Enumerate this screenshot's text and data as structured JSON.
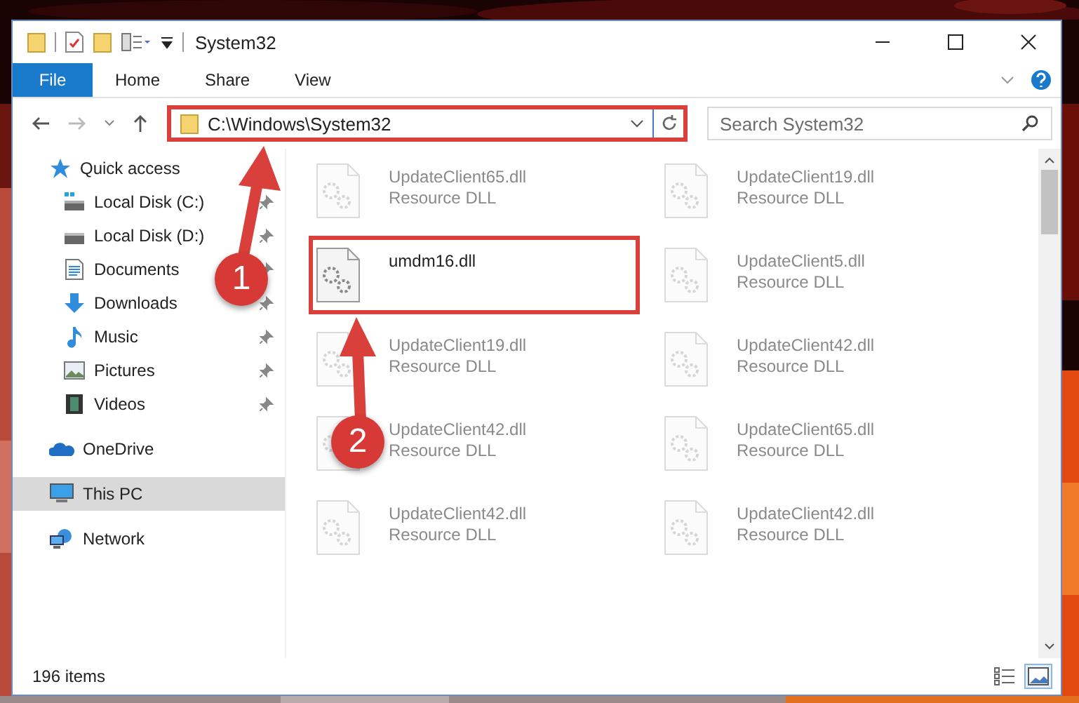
{
  "window": {
    "title": "System32"
  },
  "ribbon_tabs": [
    {
      "label": "File",
      "kind": "file"
    },
    {
      "label": "Home",
      "kind": "tab"
    },
    {
      "label": "Share",
      "kind": "tab"
    },
    {
      "label": "View",
      "kind": "tab"
    }
  ],
  "address": {
    "path": "C:\\Windows\\System32",
    "highlighted": true
  },
  "search": {
    "placeholder": "Search System32"
  },
  "sidebar": {
    "items": [
      {
        "label": "Quick access",
        "kind": "star",
        "selected": false,
        "children": [
          {
            "label": "Local Disk (C:)",
            "kind": "systemdrive",
            "pinned": true,
            "selected": false
          },
          {
            "label": "Local Disk (D:)",
            "kind": "drive",
            "pinned": true,
            "selected": false
          },
          {
            "label": "Documents",
            "kind": "documents",
            "pinned": true,
            "selected": false
          },
          {
            "label": "Downloads",
            "kind": "downloads",
            "pinned": true,
            "selected": false
          },
          {
            "label": "Music",
            "kind": "music",
            "pinned": true,
            "selected": false
          },
          {
            "label": "Pictures",
            "kind": "pictures",
            "pinned": true,
            "selected": false
          },
          {
            "label": "Videos",
            "kind": "videos",
            "pinned": true,
            "selected": false
          }
        ]
      },
      {
        "label": "OneDrive",
        "kind": "cloud",
        "selected": false
      },
      {
        "label": "This PC",
        "kind": "pc",
        "selected": true
      },
      {
        "label": "Network",
        "kind": "network",
        "selected": false
      }
    ]
  },
  "files": [
    {
      "name": "UpdateClient65.dll",
      "type": "Resource DLL",
      "dimmed": true,
      "highlighted": false
    },
    {
      "name": "UpdateClient19.dll",
      "type": "Resource DLL",
      "dimmed": true,
      "highlighted": false
    },
    {
      "name": "umdm16.dll",
      "dimmed": false,
      "highlighted": true
    },
    {
      "name": "UpdateClient5.dll",
      "type": "Resource DLL",
      "dimmed": true,
      "highlighted": false
    },
    {
      "name": "UpdateClient19.dll",
      "type": "Resource DLL",
      "dimmed": true,
      "highlighted": false
    },
    {
      "name": "UpdateClient42.dll",
      "type": "Resource DLL",
      "dimmed": true,
      "highlighted": false
    },
    {
      "name": "UpdateClient42.dll",
      "type": "Resource DLL",
      "dimmed": true,
      "highlighted": false
    },
    {
      "name": "UpdateClient65.dll",
      "type": "Resource DLL",
      "dimmed": true,
      "highlighted": false
    },
    {
      "name": "UpdateClient42.dll",
      "type": "Resource DLL",
      "dimmed": true,
      "highlighted": false
    },
    {
      "name": "UpdateClient42.dll",
      "type": "Resource DLL",
      "dimmed": true,
      "highlighted": false
    }
  ],
  "status_bar": {
    "count": "196 items"
  },
  "view_buttons": [
    {
      "kind": "details",
      "selected": false
    },
    {
      "kind": "large",
      "selected": true
    }
  ],
  "annotations": [
    {
      "number": "1"
    },
    {
      "number": "2"
    }
  ]
}
